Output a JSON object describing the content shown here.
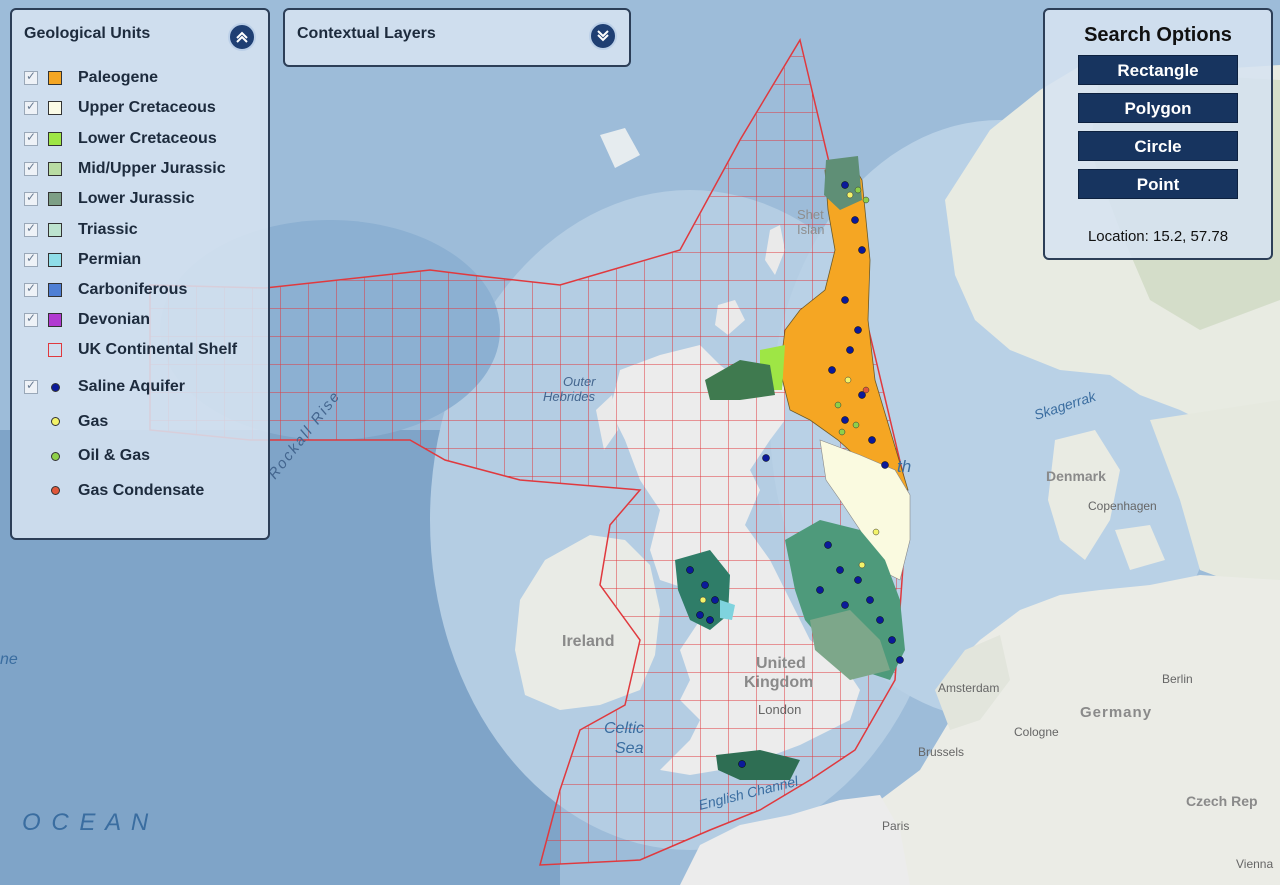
{
  "geological_units": {
    "title": "Geological Units",
    "toggle_icon": "chevron-up-icon",
    "layers": [
      {
        "label": "Paleogene",
        "color": "#f5a623",
        "checked": true
      },
      {
        "label": "Upper Cretaceous",
        "color": "#fbfbe6",
        "checked": true
      },
      {
        "label": "Lower Cretaceous",
        "color": "#9ee645",
        "checked": true
      },
      {
        "label": "Mid/Upper Jurassic",
        "color": "#b9dca3",
        "checked": true
      },
      {
        "label": "Lower Jurassic",
        "color": "#7d9f86",
        "checked": true
      },
      {
        "label": "Triassic",
        "color": "#bde3cf",
        "checked": true
      },
      {
        "label": "Permian",
        "color": "#8fdde8",
        "checked": true
      },
      {
        "label": "Carboniferous",
        "color": "#4f7fd4",
        "checked": true
      },
      {
        "label": "Devonian",
        "color": "#b13ad1",
        "checked": true
      }
    ],
    "shelf": {
      "label": "UK Continental Shelf",
      "color": "#e0393e"
    },
    "points": [
      {
        "label": "Saline Aquifer",
        "color": "#0b1a99",
        "checked": true
      },
      {
        "label": "Gas",
        "color": "#f3f36a",
        "checked": false
      },
      {
        "label": "Oil & Gas",
        "color": "#8ed04a",
        "checked": false
      },
      {
        "label": "Gas Condensate",
        "color": "#e0573a",
        "checked": false
      }
    ]
  },
  "contextual_layers": {
    "title": "Contextual Layers",
    "toggle_icon": "chevron-down-icon"
  },
  "search_options": {
    "title": "Search Options",
    "buttons": [
      "Rectangle",
      "Polygon",
      "Circle",
      "Point"
    ],
    "location_label": "Location: 15.2, 57.78"
  },
  "map_labels": {
    "ireland": "Ireland",
    "uk_line1": "United",
    "uk_line2": "Kingdom",
    "london": "London",
    "celtic_line1": "Celtic",
    "celtic_line2": "Sea",
    "english_channel": "English Channel",
    "outer_line1": "Outer",
    "outer_line2": "Hebrides",
    "rockall": "Rockall Rise",
    "ocean": "O C E A N",
    "skagerrak": "Skagerrak",
    "denmark": "Denmark",
    "copenhagen": "Copenhagen",
    "amsterdam": "Amsterdam",
    "brussels": "Brussels",
    "cologne": "Cologne",
    "berlin": "Berlin",
    "germany": "Germany",
    "czech": "Czech Rep",
    "paris": "Paris",
    "vienna": "Vienna",
    "shetland_line1": "Shet",
    "shetland_line2": "Islan",
    "north_fragment": "th",
    "left_fragment": "ne"
  }
}
